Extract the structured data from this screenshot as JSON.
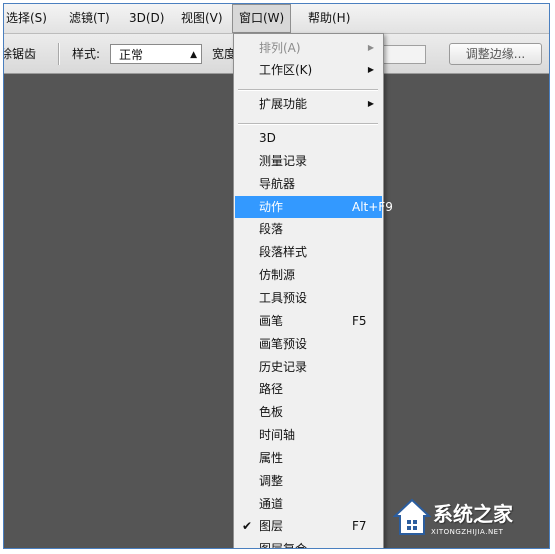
{
  "menubar": {
    "items": [
      "选择(S)",
      "滤镜(T)",
      "3D(D)",
      "视图(V)",
      "窗口(W)",
      "帮助(H)"
    ],
    "active_index": 4
  },
  "options": {
    "antialias_label": "除锯齿",
    "style_label": "样式:",
    "style_value": "正常",
    "width_label": "宽度",
    "refine_button": "调整边缘..."
  },
  "dropdown": {
    "arrange": "排列(A)",
    "workspace": "工作区(K)",
    "extensions": "扩展功能",
    "items": [
      {
        "label": "3D",
        "shortcut": ""
      },
      {
        "label": "测量记录",
        "shortcut": ""
      },
      {
        "label": "导航器",
        "shortcut": ""
      },
      {
        "label": "动作",
        "shortcut": "Alt+F9"
      },
      {
        "label": "段落",
        "shortcut": ""
      },
      {
        "label": "段落样式",
        "shortcut": ""
      },
      {
        "label": "仿制源",
        "shortcut": ""
      },
      {
        "label": "工具预设",
        "shortcut": ""
      },
      {
        "label": "画笔",
        "shortcut": "F5"
      },
      {
        "label": "画笔预设",
        "shortcut": ""
      },
      {
        "label": "历史记录",
        "shortcut": ""
      },
      {
        "label": "路径",
        "shortcut": ""
      },
      {
        "label": "色板",
        "shortcut": ""
      },
      {
        "label": "时间轴",
        "shortcut": ""
      },
      {
        "label": "属性",
        "shortcut": ""
      },
      {
        "label": "调整",
        "shortcut": ""
      },
      {
        "label": "通道",
        "shortcut": ""
      },
      {
        "label": "图层",
        "shortcut": "F7"
      },
      {
        "label": "图层复合",
        "shortcut": ""
      }
    ],
    "checkmark": "✔",
    "submenu_arrow": "▶"
  },
  "watermark": {
    "title": "系统之家",
    "url": "XITONGZHIJIA.NET"
  },
  "colors": {
    "highlight": "#3399ff",
    "workspace": "#555555",
    "menu_bg": "#f0f0f0"
  }
}
